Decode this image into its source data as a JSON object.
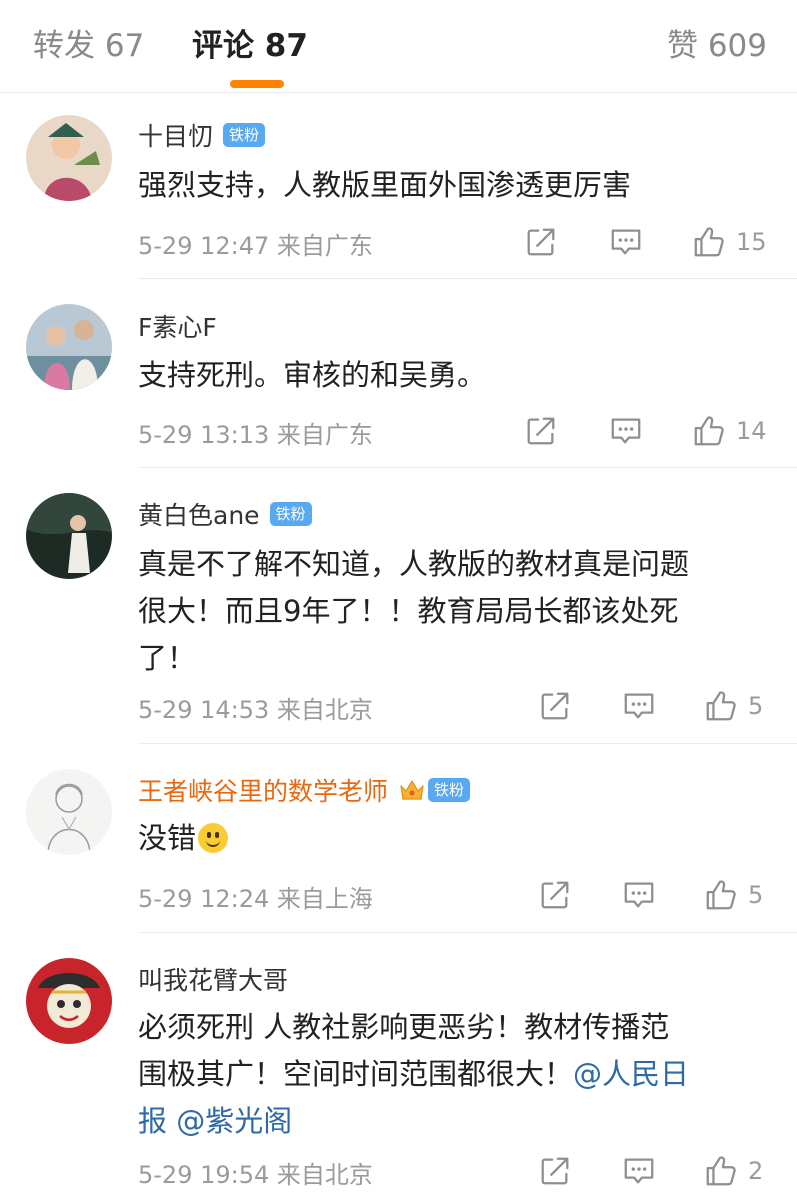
{
  "tabs": {
    "reposts": "转发 67",
    "comments": "评论 87",
    "likes": "赞 609"
  },
  "comments": [
    {
      "author": "十目忉",
      "badge": "铁粉",
      "text": "强烈支持，人教版里面外国渗透更厉害",
      "date": "5-29 12:47",
      "location": "来自广东",
      "likes": "15"
    },
    {
      "author": "F素心F",
      "text": "支持死刑。审核的和吴勇。",
      "date": "5-29 13:13",
      "location": "来自广东",
      "likes": "14"
    },
    {
      "author": "黄白色ane",
      "badge": "铁粉",
      "text_lines": [
        "真是不了解不知道，人教版的教材真是问题",
        "很大！而且9年了！！教育局局长都该处死",
        "了！"
      ],
      "date": "5-29 14:53",
      "location": "来自北京",
      "likes": "5"
    },
    {
      "author": "王者峡谷里的数学老师",
      "badge": "铁粉",
      "text": "没错",
      "emoji": "smile-emoji",
      "date": "5-29 12:24",
      "location": "来自上海",
      "likes": "5"
    },
    {
      "author": "叫我花臂大哥",
      "text_line1": "必须死刑 人教社影响更恶劣！教材传播范",
      "text_line2": "围极其广！空间时间范围都很大！",
      "mention1": "@人民日",
      "mention2": "报 @紫光阁",
      "date": "5-29 19:54",
      "location": "来自北京",
      "likes": "2"
    }
  ],
  "icons": {
    "repost": "share-icon",
    "comment": "comment-icon",
    "like": "thumbs-up-icon",
    "vip": "crown-icon"
  },
  "colors": {
    "accent": "#ff8200",
    "badge": "#58a8f2",
    "vip_name": "#e8690f",
    "link": "#2e6aa7"
  }
}
